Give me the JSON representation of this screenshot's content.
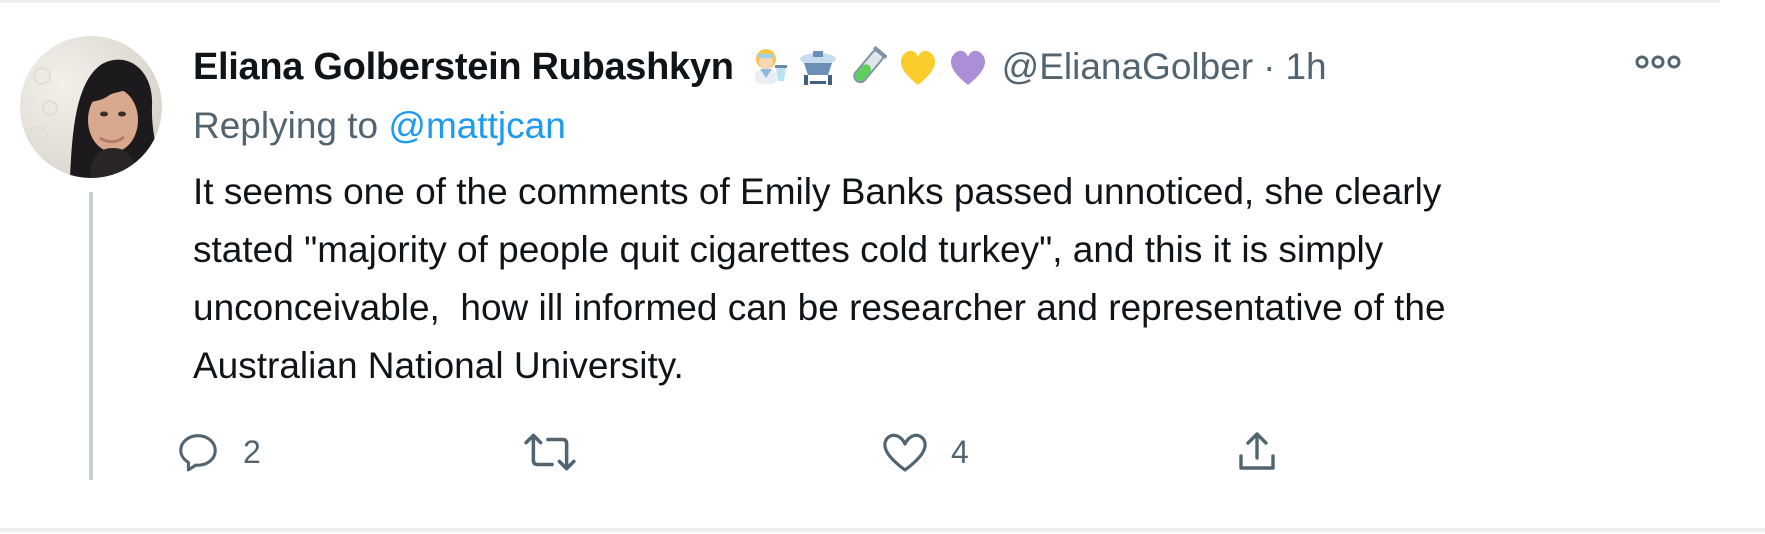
{
  "tweet": {
    "author_name": "Eliana Golberstein Rubashkyn",
    "emoji_icons": [
      "woman-scientist-icon",
      "alembic-icon",
      "test-tube-icon",
      "yellow-heart-icon",
      "purple-heart-icon"
    ],
    "handle": "@ElianaGolber",
    "separator": "·",
    "time": "1h",
    "more_icon": "more-dots-icon",
    "replying_prefix": "Replying to",
    "replying_mention": "@mattjcan",
    "body_lines": [
      "It seems one of the comments of Emily Banks passed unnoticed, she clearly",
      "stated \"majority of people quit cigarettes cold turkey\", and this it is simply",
      "unconceivable,  how ill informed can be researcher and representative of the",
      "Australian National University."
    ],
    "actions": {
      "reply": {
        "icon": "reply-icon",
        "count": "2"
      },
      "retweet": {
        "icon": "retweet-icon",
        "count": ""
      },
      "like": {
        "icon": "like-icon",
        "count": "4"
      },
      "share": {
        "icon": "share-icon",
        "count": ""
      }
    }
  },
  "colors": {
    "text_primary": "#0f1419",
    "text_secondary": "#536471",
    "link": "#1d9bf0",
    "thread_line": "#c4cfd6"
  }
}
